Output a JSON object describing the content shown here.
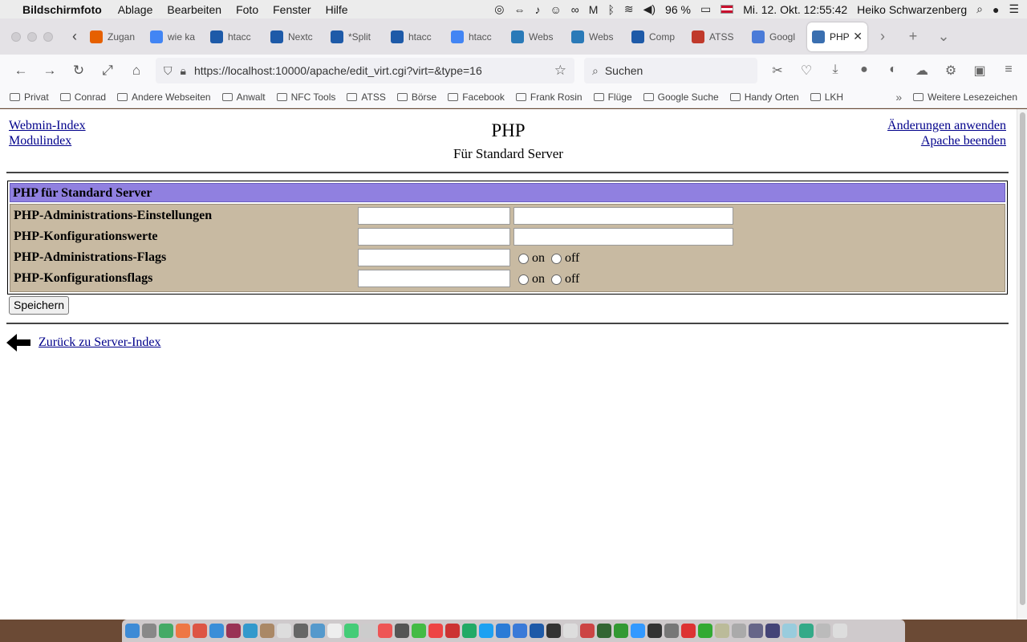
{
  "menubar": {
    "app": "Bildschirmfoto",
    "menus": [
      "Ablage",
      "Bearbeiten",
      "Foto",
      "Fenster",
      "Hilfe"
    ],
    "battery": "96 %",
    "datetime": "Mi. 12. Okt.  12:55:42",
    "user": "Heiko Schwarzenberg"
  },
  "tabs": [
    {
      "label": "Zugan",
      "color": "#e66000"
    },
    {
      "label": "wie ka",
      "color": "#4285f4"
    },
    {
      "label": "htacc",
      "color": "#1e5aa8"
    },
    {
      "label": "Nextc",
      "color": "#1e5aa8"
    },
    {
      "label": "*Split",
      "color": "#1e5aa8"
    },
    {
      "label": "htacc",
      "color": "#1e5aa8"
    },
    {
      "label": "htacc",
      "color": "#4285f4"
    },
    {
      "label": "Webs",
      "color": "#2a7ab8"
    },
    {
      "label": "Webs",
      "color": "#2a7ab8"
    },
    {
      "label": "Comp",
      "color": "#1e5aa8"
    },
    {
      "label": "ATSS",
      "color": "#c0392b"
    },
    {
      "label": "Googl",
      "color": "#4a7bd8"
    },
    {
      "label": "PHP",
      "color": "#3a6fb0",
      "active": true
    }
  ],
  "navbar": {
    "url": "https://localhost:10000/apache/edit_virt.cgi?virt=&type=16",
    "search_placeholder": "Suchen"
  },
  "bookmarks": [
    "Privat",
    "Conrad",
    "Andere Webseiten",
    "Anwalt",
    "NFC Tools",
    "ATSS",
    "Börse",
    "Facebook",
    "Frank Rosin",
    "Flüge",
    "Google Suche",
    "Handy Orten",
    "LKH"
  ],
  "bookmarks_more": "Weitere Lesezeichen",
  "page": {
    "link_webmin_index": "Webmin-Index",
    "link_module_index": "Modulindex",
    "title": "PHP",
    "subtitle": "Für Standard Server",
    "link_apply": "Änderungen anwenden",
    "link_stop": "Apache beenden",
    "section_title": "PHP für Standard Server",
    "rows": [
      {
        "label": "PHP-Administrations-Einstellungen",
        "kind": "pair"
      },
      {
        "label": "PHP-Konfigurationswerte",
        "kind": "pair"
      },
      {
        "label": "PHP-Administrations-Flags",
        "kind": "flag",
        "on": "on",
        "off": "off"
      },
      {
        "label": "PHP-Konfigurationsflags",
        "kind": "flag",
        "on": "on",
        "off": "off"
      }
    ],
    "save_label": "Speichern",
    "back_label": "Zurück zu Server-Index"
  },
  "colors": {
    "section_bar": "#9080e0",
    "form_body": "#c8baa2",
    "link": "#00008b"
  }
}
